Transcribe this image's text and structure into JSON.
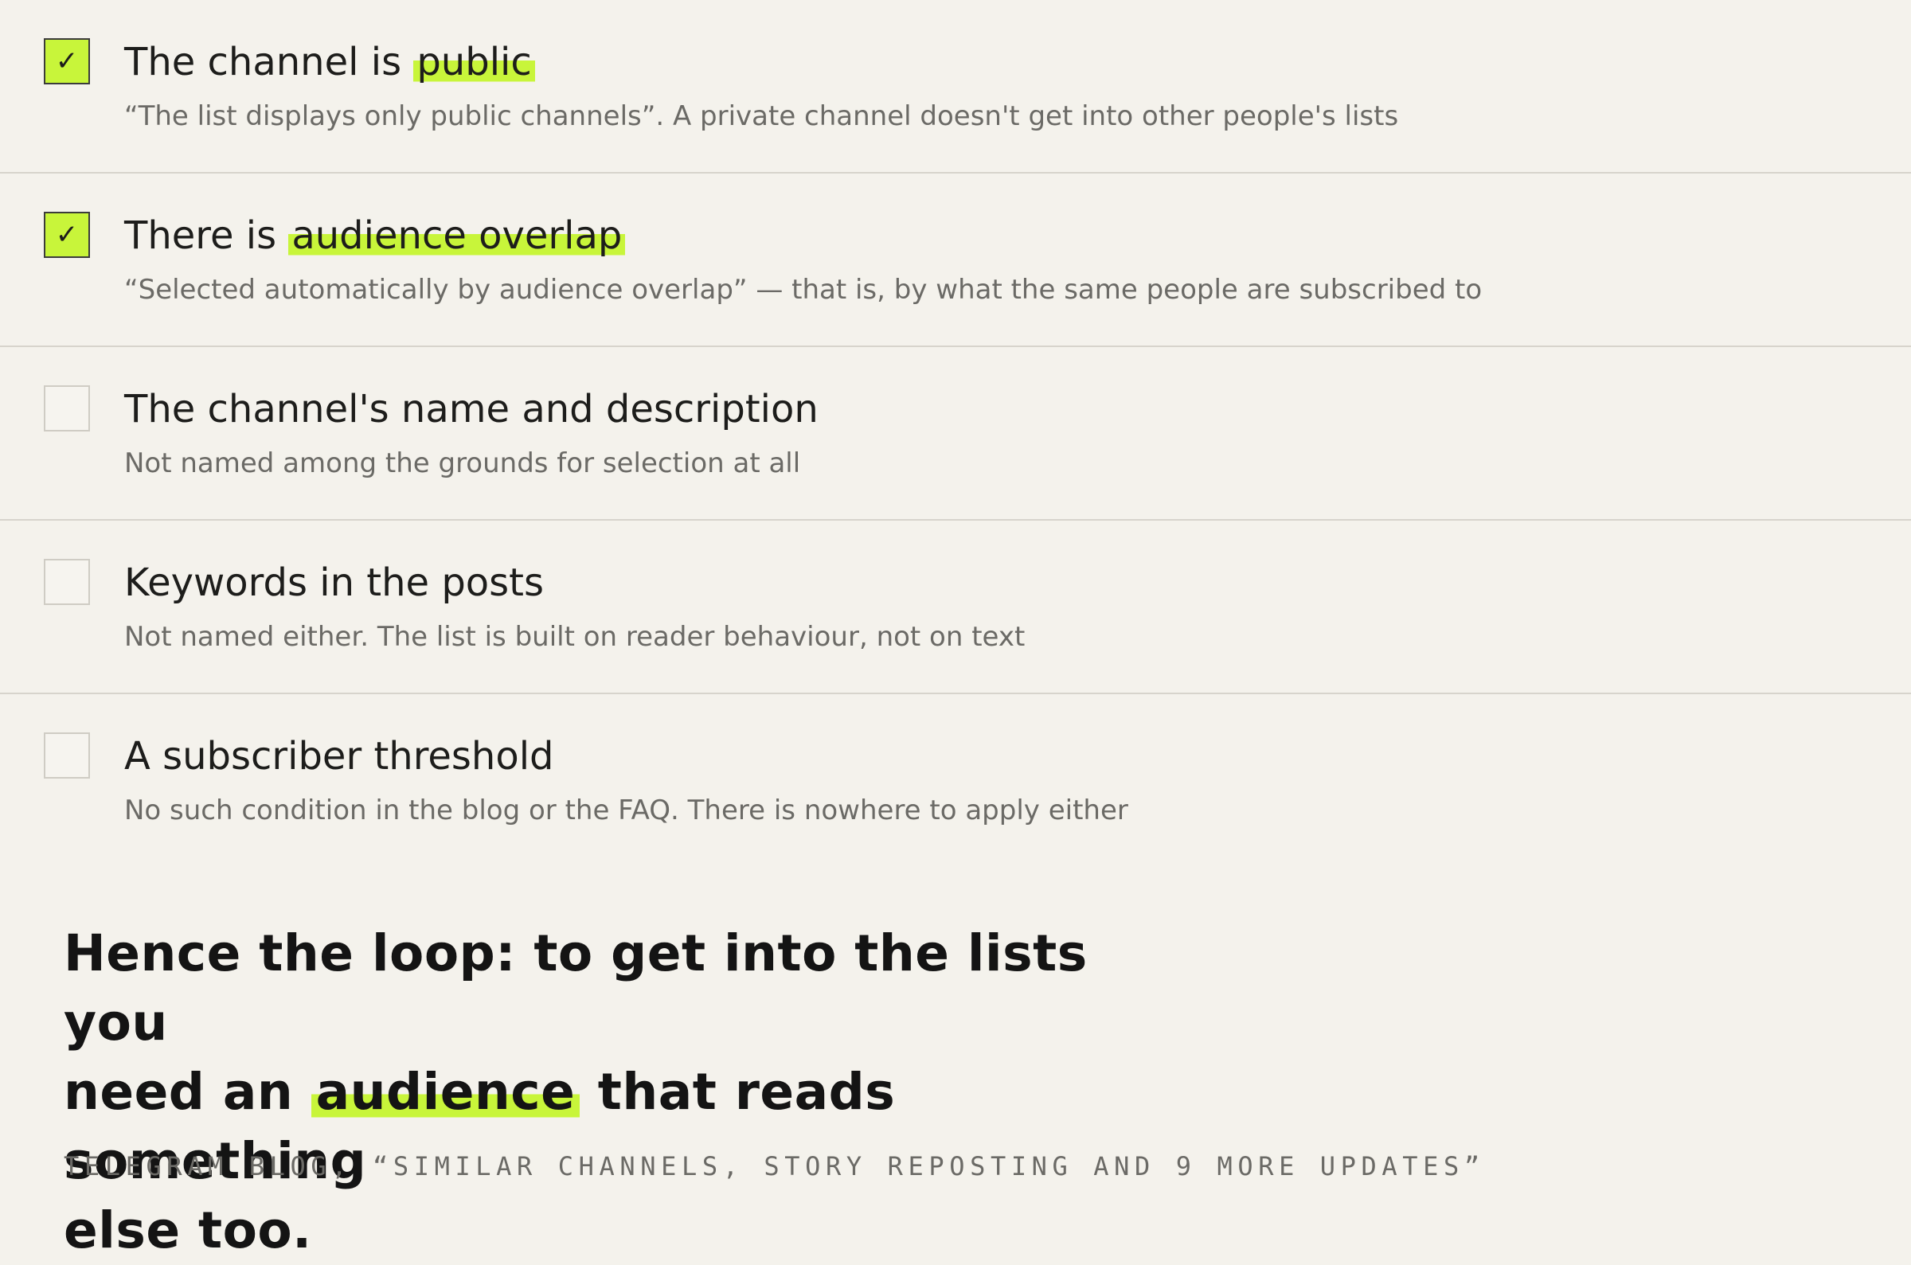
{
  "criteria": [
    {
      "checked": true,
      "check_glyph": "✓",
      "title_before": "The channel is ",
      "title_highlight": "public",
      "title_after": "",
      "description": "“The list displays only public channels”. A private channel doesn't get into other people's lists"
    },
    {
      "checked": true,
      "check_glyph": "✓",
      "title_before": "There is ",
      "title_highlight": "audience overlap",
      "title_after": "",
      "description": "“Selected automatically by audience overlap” — that is, by what the same people are subscribed to"
    },
    {
      "checked": false,
      "check_glyph": "",
      "title_before": "The channel's name and description",
      "title_highlight": "",
      "title_after": "",
      "description": "Not named among the grounds for selection at all"
    },
    {
      "checked": false,
      "check_glyph": "",
      "title_before": "Keywords in the posts",
      "title_highlight": "",
      "title_after": "",
      "description": "Not named either. The list is built on reader behaviour, not on text"
    },
    {
      "checked": false,
      "check_glyph": "",
      "title_before": "A subscriber threshold",
      "title_highlight": "",
      "title_after": "",
      "description": "No such condition in the blog or the FAQ. There is nowhere to apply either"
    }
  ],
  "quote": {
    "line1": "Hence the loop: to get into the lists you",
    "line2_before": "need an ",
    "line2_highlight": "audience",
    "line2_after": " that reads something",
    "line3": "else too."
  },
  "source": "TELEGRAM BLOG, “SIMILAR CHANNELS, STORY REPOSTING AND 9 MORE UPDATES”",
  "colors": {
    "background": "#f4f2ec",
    "highlight": "#c8f53a",
    "text": "#1d1d1b",
    "muted": "#6b6a66",
    "divider": "#d7d4cc"
  }
}
